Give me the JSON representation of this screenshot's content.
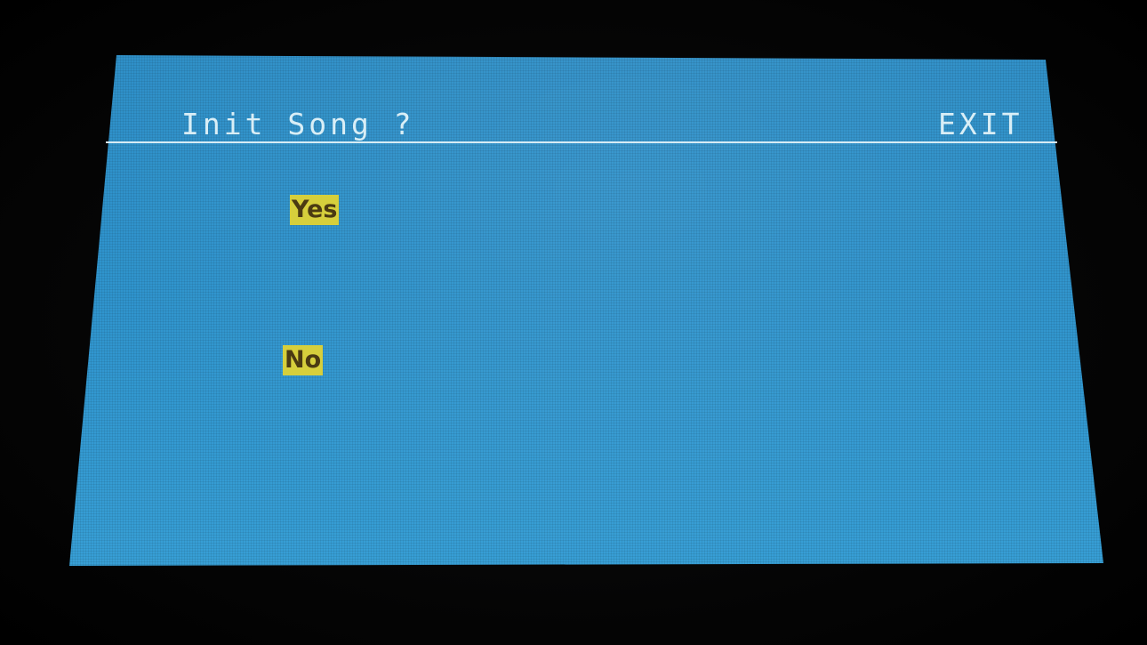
{
  "header": {
    "title": "Init Song ?",
    "exit_label": "EXIT"
  },
  "dialog": {
    "options": [
      {
        "label": "Yes"
      },
      {
        "label": "No"
      }
    ]
  },
  "colors": {
    "screen_background": "#2f94cd",
    "text": "#d9eef6",
    "highlight": "#d6cf3c",
    "highlight_text": "#4a3a12",
    "bezel": "#050505"
  }
}
